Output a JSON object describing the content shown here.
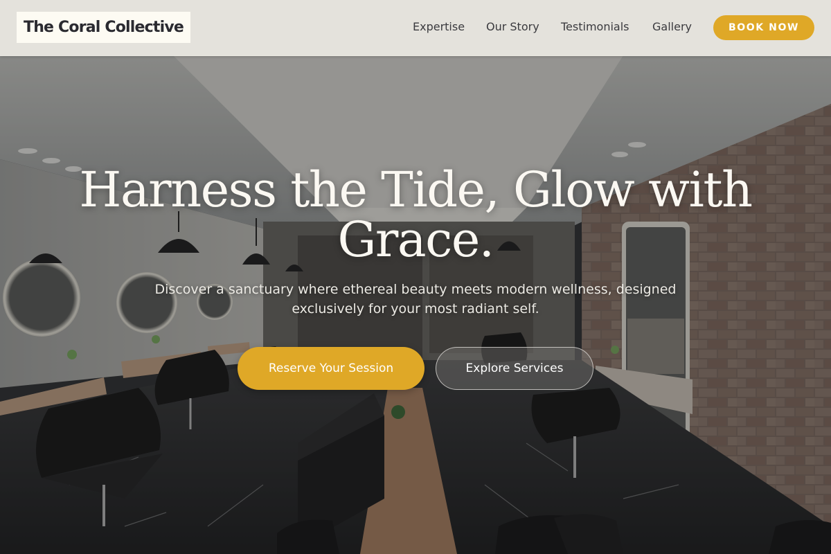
{
  "header": {
    "logo": "The Coral Collective",
    "nav": [
      {
        "label": "Expertise"
      },
      {
        "label": "Our Story"
      },
      {
        "label": "Testimonials"
      },
      {
        "label": "Gallery"
      }
    ],
    "cta": "BOOK NOW"
  },
  "hero": {
    "title": "Harness the Tide, Glow with Grace.",
    "subtitle": "Discover a sanctuary where ethereal beauty meets modern wellness, designed exclusively for your most radiant self.",
    "primary_button": "Reserve Your Session",
    "secondary_button": "Explore Services",
    "background_image": "salon-interior"
  },
  "colors": {
    "accent": "#dfa827",
    "header_bg": "#eeece6",
    "text_light": "#fbf8f2"
  }
}
